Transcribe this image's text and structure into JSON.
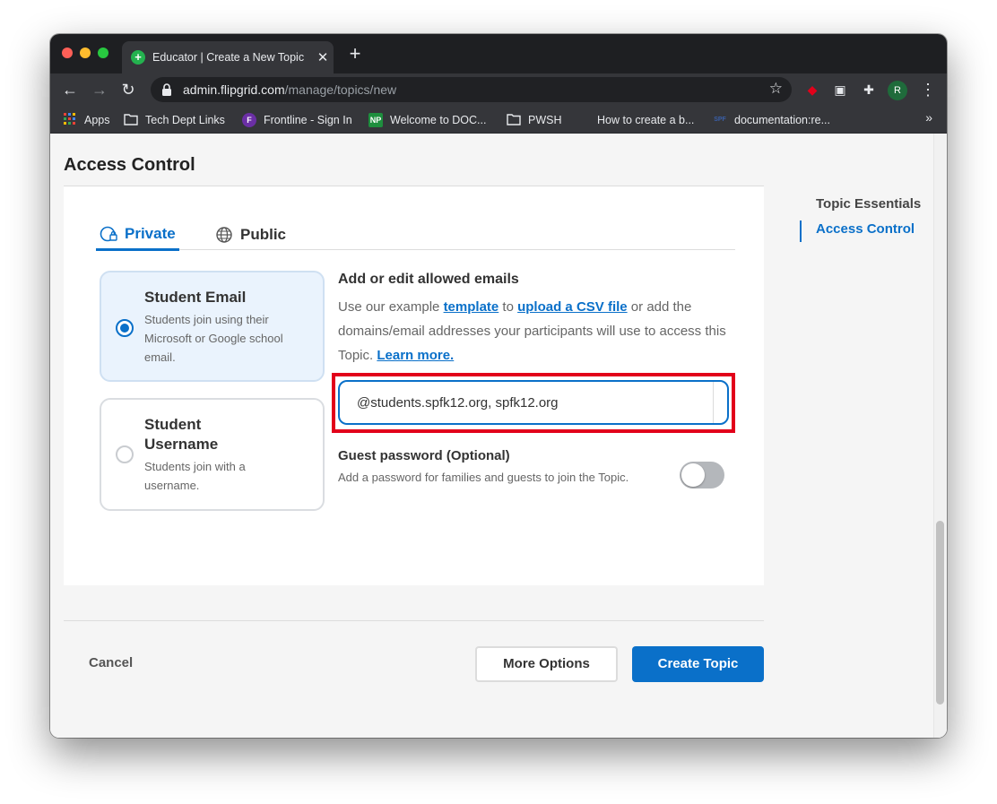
{
  "browser": {
    "tab_title": "Educator | Create a New Topic",
    "url_host": "admin.flipgrid.com",
    "url_path": "/manage/topics/new",
    "profile_initial": "R",
    "bookmarks": [
      {
        "label": "Apps",
        "icon": "apps-grid-icon"
      },
      {
        "label": "Tech Dept Links",
        "icon": "folder-icon"
      },
      {
        "label": "Frontline - Sign In",
        "icon": "frontline-icon"
      },
      {
        "label": "Welcome to DOC...",
        "icon": "np-icon"
      },
      {
        "label": "PWSH",
        "icon": "folder-icon"
      },
      {
        "label": "How to create a b...",
        "icon": "apple-icon"
      },
      {
        "label": "documentation:re...",
        "icon": "spf-icon"
      }
    ],
    "overflow_label": "»"
  },
  "page": {
    "section_title": "Access Control",
    "tabs": [
      {
        "label": "Private",
        "active": true,
        "icon": "private-lock-icon"
      },
      {
        "label": "Public",
        "active": false,
        "icon": "globe-icon"
      }
    ],
    "options": [
      {
        "title": "Student Email",
        "description": "Students join using their Microsoft or Google school email.",
        "selected": true
      },
      {
        "title": "Student Username",
        "description": "Students join with a username.",
        "selected": false
      }
    ],
    "allowed": {
      "title": "Add or edit allowed emails",
      "desc_1": "Use our example ",
      "template_link": "template",
      "desc_2": " to ",
      "csv_link": "upload a CSV file",
      "desc_3": " or add the domains/email addresses your participants will use to access this Topic. ",
      "learn_link": "Learn more.",
      "input_value": "@students.spfk12.org, spfk12.org"
    },
    "guest": {
      "title": "Guest password (Optional)",
      "description": "Add a password for families and guests to join the Topic.",
      "enabled": false
    },
    "footer": {
      "cancel_label": "Cancel",
      "more_label": "More Options",
      "create_label": "Create Topic"
    },
    "side_nav": [
      {
        "label": "Topic Essentials",
        "active": false
      },
      {
        "label": "Access Control",
        "active": true
      }
    ]
  },
  "colors": {
    "accent": "#0a70c9",
    "highlight": "#e2001a",
    "selected_option_bg": "#eaf3fd"
  }
}
